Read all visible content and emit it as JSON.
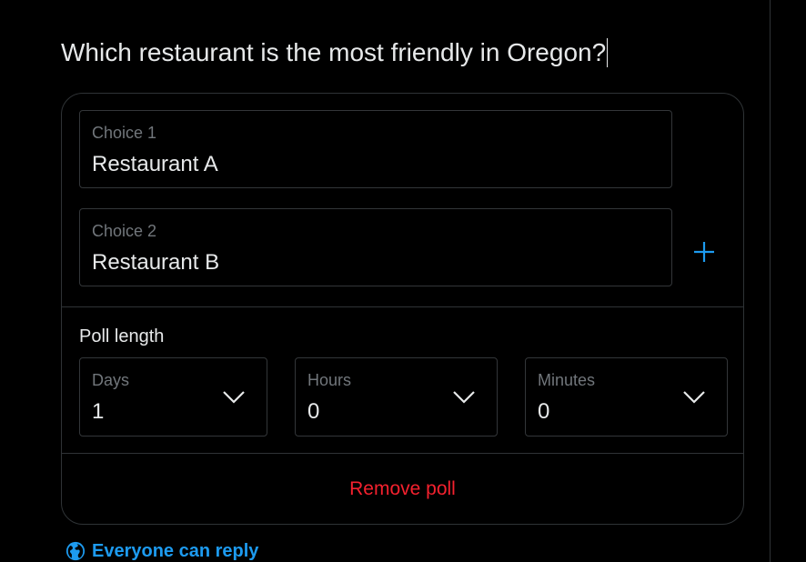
{
  "composer": {
    "text": "Which restaurant is the most friendly in Oregon?"
  },
  "poll": {
    "choices": [
      {
        "label": "Choice 1",
        "value": "Restaurant A"
      },
      {
        "label": "Choice 2",
        "value": "Restaurant B"
      }
    ],
    "add_choice_icon": "plus-icon",
    "length_title": "Poll length",
    "days": {
      "label": "Days",
      "value": "1"
    },
    "hours": {
      "label": "Hours",
      "value": "0"
    },
    "minutes": {
      "label": "Minutes",
      "value": "0"
    },
    "remove_label": "Remove poll"
  },
  "reply_setting": {
    "icon": "globe-icon",
    "label": "Everyone can reply"
  },
  "colors": {
    "background": "#000000",
    "text": "#e7e9ea",
    "muted": "#71767b",
    "border": "#2f3336",
    "accent": "#1d9bf0",
    "danger": "#f4212e"
  }
}
